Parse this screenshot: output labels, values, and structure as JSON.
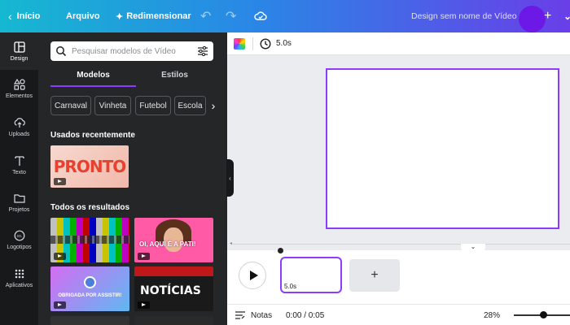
{
  "topbar": {
    "back_label": "Início",
    "arquivo_label": "Arquivo",
    "resize_label": "Redimensionar",
    "design_title": "Design sem nome de Vídeo"
  },
  "rail": {
    "items": [
      {
        "label": "Design",
        "icon": "layout-icon"
      },
      {
        "label": "Elementos",
        "icon": "shapes-icon"
      },
      {
        "label": "Uploads",
        "icon": "cloud-upload-icon"
      },
      {
        "label": "Texto",
        "icon": "text-icon"
      },
      {
        "label": "Projetos",
        "icon": "folder-icon"
      },
      {
        "label": "Logotipos",
        "icon": "logo-icon"
      },
      {
        "label": "Aplicativos",
        "icon": "apps-grid-icon"
      }
    ]
  },
  "panel": {
    "search_placeholder": "Pesquisar modelos de Vídeo",
    "tabs": [
      "Modelos",
      "Estilos"
    ],
    "chips": [
      "Carnaval",
      "Vinheta",
      "Futebol",
      "Escola"
    ],
    "recent_title": "Usados recentemente",
    "recent_thumb_text": "PRONTO",
    "results_title": "Todos os resultados",
    "thumb_texts": {
      "pink": "OI, AQUI É A PATI!",
      "gradient": "OBRIGADA POR ASSISTIR!",
      "news": "NOTÍCIAS"
    }
  },
  "toolbar": {
    "duration": "5.0s"
  },
  "timeline": {
    "clip_duration": "5.0s"
  },
  "bottombar": {
    "notes_label": "Notas",
    "time": "0:00 / 0:05",
    "zoom": "28%"
  },
  "colors": {
    "accent": "#8b3dff",
    "panel_bg": "#252627",
    "rail_bg": "#18191b"
  }
}
